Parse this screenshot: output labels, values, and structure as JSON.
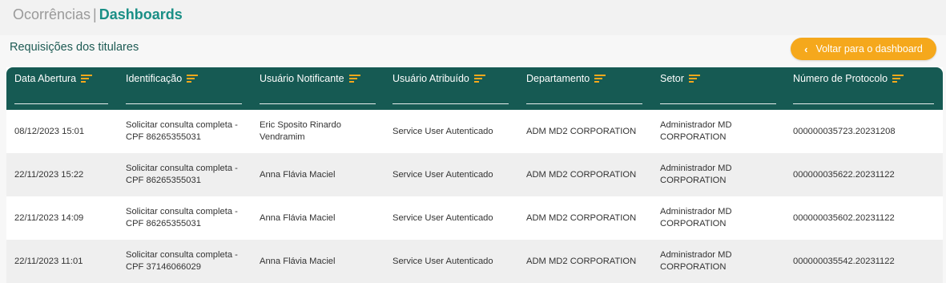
{
  "breadcrumb": {
    "parent": "Ocorrências",
    "separator": "|",
    "current": "Dashboards"
  },
  "section": {
    "title": "Requisições dos titulares"
  },
  "back_button": {
    "label": "Voltar para o dashboard",
    "icon": "chevron-left-icon"
  },
  "colors": {
    "header_bg": "#165a53",
    "accent": "#f5a81c",
    "brand": "#1a8f86"
  },
  "columns": [
    "Data Abertura",
    "Identificação",
    "Usuário Notificante",
    "Usuário Atribuído",
    "Departamento",
    "Setor",
    "Número de Protocolo"
  ],
  "rows": [
    [
      "08/12/2023 15:01",
      "Solicitar consulta completa - CPF 86265355031",
      "Eric Sposito Rinardo Vendramim",
      "Service User Autenticado",
      "ADM MD2 CORPORATION",
      "Administrador MD CORPORATION",
      "000000035723.20231208"
    ],
    [
      "22/11/2023 15:22",
      "Solicitar consulta completa - CPF 86265355031",
      "Anna Flávia Maciel",
      "Service User Autenticado",
      "ADM MD2 CORPORATION",
      "Administrador MD CORPORATION",
      "000000035622.20231122"
    ],
    [
      "22/11/2023 14:09",
      "Solicitar consulta completa - CPF 86265355031",
      "Anna Flávia Maciel",
      "Service User Autenticado",
      "ADM MD2 CORPORATION",
      "Administrador MD CORPORATION",
      "000000035602.20231122"
    ],
    [
      "22/11/2023 11:01",
      "Solicitar consulta completa - CPF 37146066029",
      "Anna Flávia Maciel",
      "Service User Autenticado",
      "ADM MD2 CORPORATION",
      "Administrador MD CORPORATION",
      "000000035542.20231122"
    ]
  ]
}
